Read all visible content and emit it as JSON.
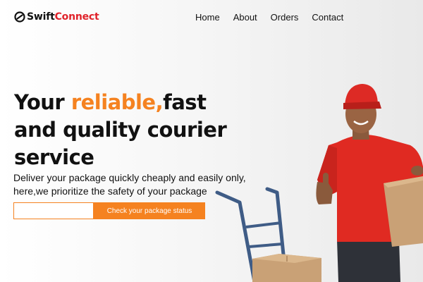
{
  "brand": {
    "name_part1": "Swift",
    "name_part2": "Connect",
    "accent_color": "#e0232b"
  },
  "nav": {
    "items": [
      {
        "label": "Home"
      },
      {
        "label": "About"
      },
      {
        "label": "Orders"
      },
      {
        "label": "Contact"
      }
    ]
  },
  "hero": {
    "headline_part1": "Your ",
    "headline_accent": "reliable,",
    "headline_part2": "fast and quality courier service",
    "subtitle": "Deliver your package quickly cheaply and easily only, here,we prioritize the safety of your package",
    "accent_color": "#f58220"
  },
  "tracking": {
    "input_value": "",
    "input_placeholder": "",
    "button_label": "Check your package status"
  },
  "illustration": {
    "icons": [
      "courier-photo",
      "hand-truck-icon",
      "cardboard-box-icon"
    ]
  }
}
